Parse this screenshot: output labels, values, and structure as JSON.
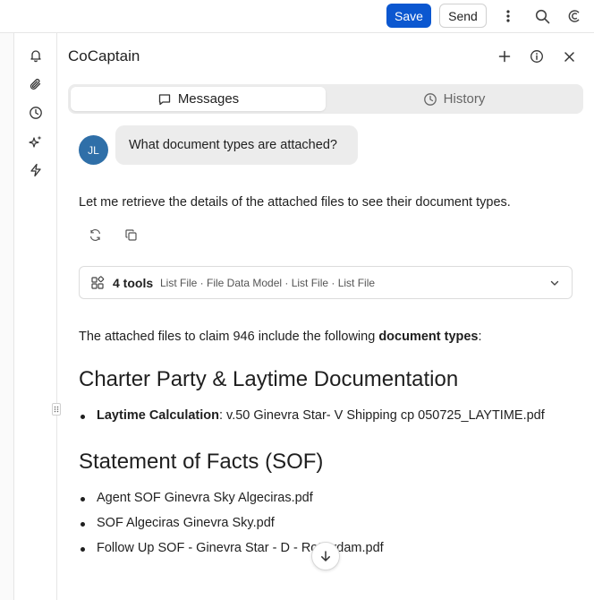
{
  "toolbar": {
    "save_label": "Save",
    "send_label": "Send"
  },
  "panel": {
    "title": "CoCaptain"
  },
  "tabs": [
    {
      "label": "Messages",
      "icon": "message-square-icon",
      "active": true
    },
    {
      "label": "History",
      "icon": "clock-icon",
      "active": false
    }
  ],
  "user": {
    "initials": "JL",
    "avatar_color": "#2f6fa8",
    "message": "What document types are attached?"
  },
  "assistant": {
    "reply": "Let me retrieve the details of the attached files to see their document types.",
    "tools": {
      "count_label": "4 tools",
      "list": "List File · File Data Model · List File · List File"
    },
    "intro_prefix": "The attached files to claim 946 include the following ",
    "intro_bold": "document types",
    "intro_suffix": ":",
    "sections": [
      {
        "heading": "Charter Party & Laytime Documentation",
        "items": [
          {
            "label": "Laytime Calculation",
            "text": ": v.50 Ginevra Star- V Shipping cp 050725_LAYTIME.pdf"
          }
        ]
      },
      {
        "heading": "Statement of Facts (SOF)",
        "items": [
          {
            "text": "Agent SOF Ginevra Sky Algeciras.pdf"
          },
          {
            "text": "SOF Algeciras Ginevra Sky.pdf"
          },
          {
            "text": "Follow Up SOF - Ginevra Star - D - Rotterdam.pdf"
          }
        ]
      }
    ]
  },
  "colors": {
    "accent": "#0b57d0",
    "bubble_bg": "#ececec"
  }
}
